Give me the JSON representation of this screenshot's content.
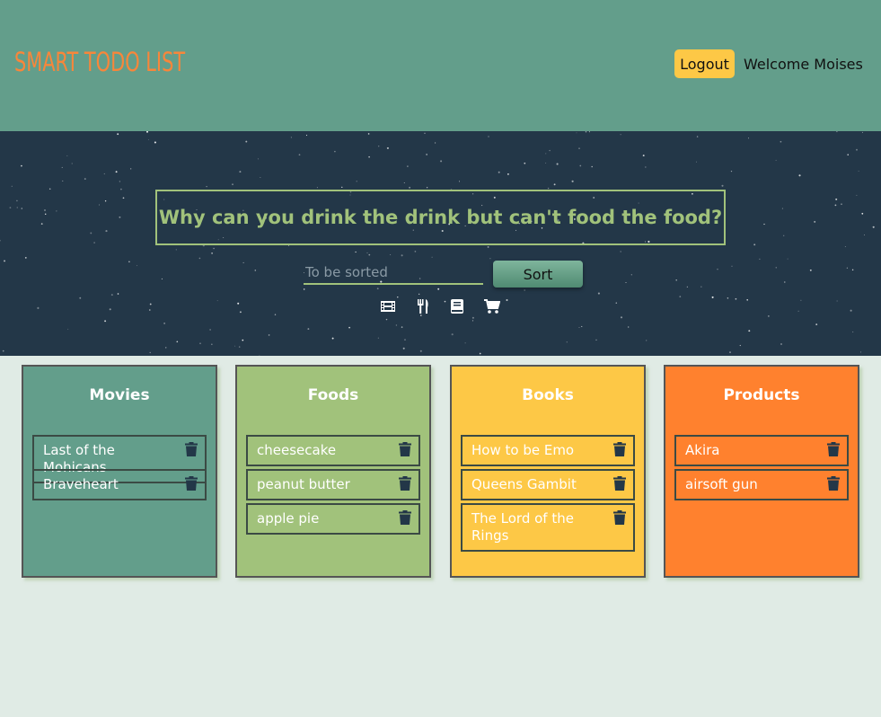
{
  "header": {
    "brand": "SMART TODO LIST",
    "logout_label": "Logout",
    "welcome": "Welcome Moises"
  },
  "hero": {
    "quote": "Why can you drink the drink but can't food the food?",
    "input_placeholder": "To be sorted",
    "sort_label": "Sort",
    "category_icons": [
      "film-icon",
      "utensils-icon",
      "book-icon",
      "cart-icon"
    ]
  },
  "colors": {
    "header_bg": "#639e8b",
    "brand": "#f8863a",
    "logout_bg": "#fdc846",
    "hero_bg": "#233748",
    "quote": "#a1c27b",
    "movies_bg": "#639e8b",
    "foods_bg": "#a1c27b",
    "books_bg": "#fdc846",
    "products_bg": "#ff812e",
    "page_bg": "#e0ebe5"
  },
  "boards": [
    {
      "title": "Movies",
      "items": [
        "Last of the Mohicans",
        "Braveheart"
      ]
    },
    {
      "title": "Foods",
      "items": [
        "cheesecake",
        "peanut butter",
        "apple pie"
      ]
    },
    {
      "title": "Books",
      "items": [
        "How to be Emo",
        "Queens Gambit",
        "The Lord of the Rings"
      ]
    },
    {
      "title": "Products",
      "items": [
        "Akira",
        "airsoft gun"
      ]
    }
  ]
}
